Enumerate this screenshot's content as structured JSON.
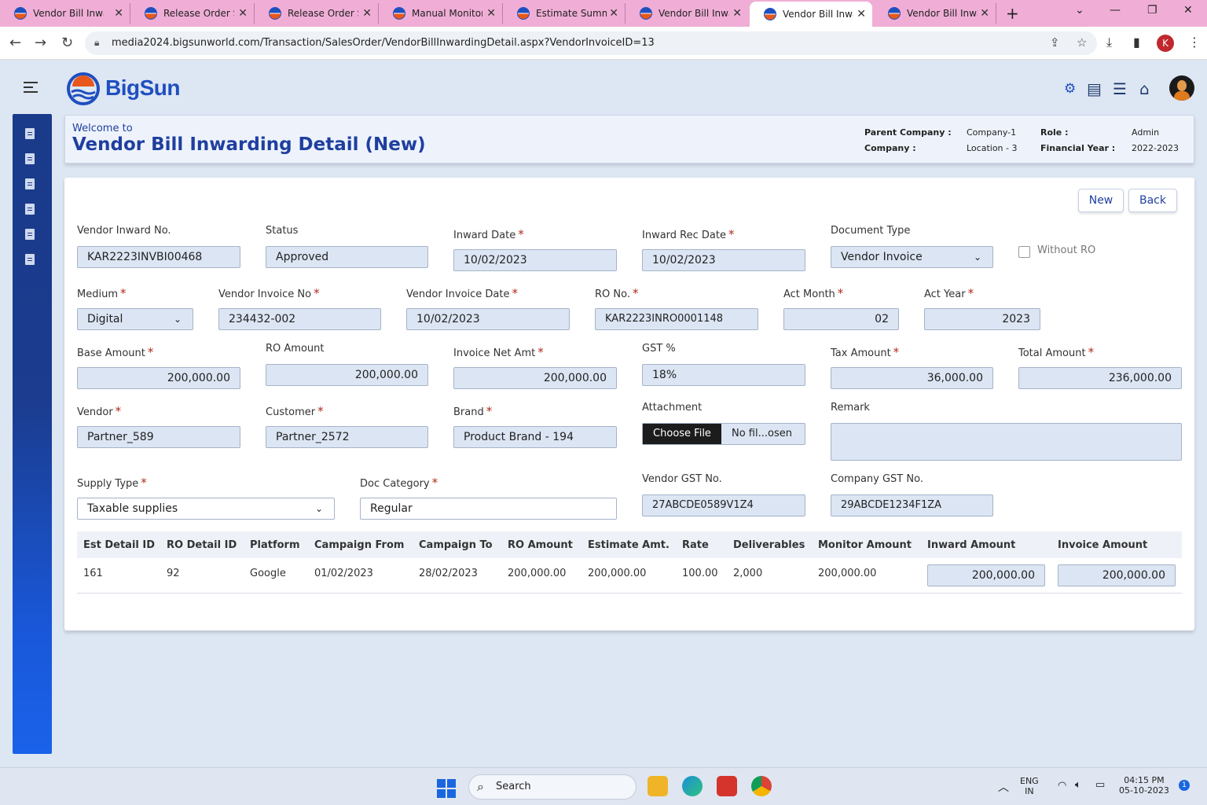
{
  "browser": {
    "tabs": [
      {
        "title": "Vendor Bill Inwar"
      },
      {
        "title": "Release Order Su"
      },
      {
        "title": "Release Order Su"
      },
      {
        "title": "Manual Monitori"
      },
      {
        "title": "Estimate Summa"
      },
      {
        "title": "Vendor Bill Inwar"
      },
      {
        "title": "Vendor Bill Inwar"
      },
      {
        "title": "Vendor Bill Inwar"
      }
    ],
    "active_tab_index": 6,
    "url": "media2024.bigsunworld.com/Transaction/SalesOrder/VendorBillInwardingDetail.aspx?VendorInvoiceID=13",
    "profile_initial": "K"
  },
  "app": {
    "brand": "BigSun",
    "welcome": "Welcome to",
    "page_title": "Vendor Bill Inwarding Detail (New)",
    "meta": {
      "parent_company_label": "Parent Company :",
      "parent_company_value": "Company-1",
      "company_label": "Company :",
      "company_value": "Location - 3",
      "role_label": "Role :",
      "role_value": "Admin",
      "fy_label": "Financial Year :",
      "fy_value": "2022-2023"
    },
    "header_icons": [
      "gear-icon",
      "list-box-icon",
      "list-icon",
      "home-icon",
      "user-avatar"
    ]
  },
  "actions": {
    "new_label": "New",
    "back_label": "Back"
  },
  "form": {
    "vendor_inward_no": {
      "label": "Vendor Inward No.",
      "value": "KAR2223INVBI00468"
    },
    "status": {
      "label": "Status",
      "value": "Approved"
    },
    "inward_date": {
      "label": "Inward Date",
      "value": "10/02/2023"
    },
    "inward_rec_date": {
      "label": "Inward Rec Date",
      "value": "10/02/2023"
    },
    "document_type": {
      "label": "Document Type",
      "value": "Vendor Invoice"
    },
    "without_ro": {
      "label": "Without RO",
      "checked": false
    },
    "medium": {
      "label": "Medium",
      "value": "Digital"
    },
    "vendor_invoice_no": {
      "label": "Vendor Invoice No",
      "value": "234432-002"
    },
    "vendor_invoice_date": {
      "label": "Vendor Invoice Date",
      "value": "10/02/2023"
    },
    "ro_no": {
      "label": "RO No.",
      "value": "KAR2223INRO0001148"
    },
    "act_month": {
      "label": "Act Month",
      "value": "02"
    },
    "act_year": {
      "label": "Act Year",
      "value": "2023"
    },
    "base_amount": {
      "label": "Base Amount",
      "value": "200,000.00"
    },
    "ro_amount": {
      "label": "RO Amount",
      "value": "200,000.00"
    },
    "invoice_net_amt": {
      "label": "Invoice Net Amt",
      "value": "200,000.00"
    },
    "gst_pct": {
      "label": "GST %",
      "value": "18%"
    },
    "tax_amount": {
      "label": "Tax Amount",
      "value": "36,000.00"
    },
    "total_amount": {
      "label": "Total Amount",
      "value": "236,000.00"
    },
    "vendor": {
      "label": "Vendor",
      "value": "Partner_589"
    },
    "customer": {
      "label": "Customer",
      "value": "Partner_2572"
    },
    "brand": {
      "label": "Brand",
      "value": "Product Brand - 194"
    },
    "attachment": {
      "label": "Attachment",
      "button": "Choose File",
      "filename": "No fil...osen"
    },
    "remark": {
      "label": "Remark",
      "value": ""
    },
    "supply_type": {
      "label": "Supply Type",
      "value": "Taxable supplies"
    },
    "doc_category": {
      "label": "Doc Category",
      "value": "Regular"
    },
    "vendor_gst": {
      "label": "Vendor GST No.",
      "value": "27ABCDE0589V1Z4"
    },
    "company_gst": {
      "label": "Company GST No.",
      "value": "29ABCDE1234F1ZA"
    }
  },
  "table": {
    "headers": [
      "Est Detail ID",
      "RO Detail ID",
      "Platform",
      "Campaign From",
      "Campaign To",
      "RO Amount",
      "Estimate Amt.",
      "Rate",
      "Deliverables",
      "Monitor Amount",
      "Inward Amount",
      "Invoice Amount"
    ],
    "rows": [
      [
        "161",
        "92",
        "Google",
        "01/02/2023",
        "28/02/2023",
        "200,000.00",
        "200,000.00",
        "100.00",
        "2,000",
        "200,000.00",
        "200,000.00",
        "200,000.00"
      ]
    ]
  },
  "taskbar": {
    "search_placeholder": "Search",
    "lang": "ENG",
    "region": "IN",
    "time": "04:15 PM",
    "date": "05-10-2023",
    "notification_count": "1"
  }
}
